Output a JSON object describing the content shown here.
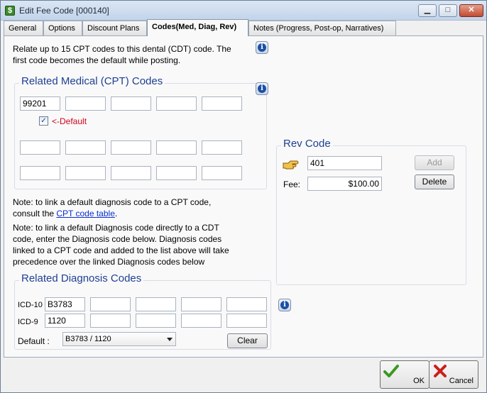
{
  "window": {
    "title": "Edit Fee Code [000140]",
    "buttons": {
      "minimize": "▁",
      "maximize": "□",
      "close": "✕"
    }
  },
  "tabs": [
    {
      "label": "General"
    },
    {
      "label": "Options"
    },
    {
      "label": "Discount Plans"
    },
    {
      "label": "Codes(Med, Diag, Rev)",
      "active": true
    },
    {
      "label": "Notes (Progress, Post-op, Narratives)"
    }
  ],
  "intro": {
    "line1": "Relate up to 15 CPT codes to this dental (CDT) code.  The",
    "line2": "first code becomes the default while posting."
  },
  "cpt": {
    "title": "Related Medical (CPT) Codes",
    "codes": [
      "99201",
      "",
      "",
      "",
      "",
      "",
      "",
      "",
      "",
      "",
      "",
      "",
      "",
      "",
      ""
    ],
    "default_checked": true,
    "default_label": "<-Default"
  },
  "notes": {
    "note1_line1": "Note: to link a default diagnosis code to a CPT code,",
    "note1_line2_prefix": "consult the ",
    "note1_link": "CPT code table",
    "note1_line2_suffix": ".",
    "note2_line1": "Note: to link a default Diagnosis code directly to a CDT",
    "note2_line2": "code, enter the Diagnosis code below. Diagnosis codes",
    "note2_line3": "linked to a CPT code and added to the list above will take",
    "note2_line4": "precedence over the linked Diagnosis codes below"
  },
  "diagnosis": {
    "title": "Related Diagnosis Codes",
    "icd10_label": "ICD-10",
    "icd9_label": "ICD-9",
    "icd10_codes": [
      "B3783",
      "",
      "",
      "",
      "",
      ""
    ],
    "icd9_codes": [
      "1120",
      "",
      "",
      "",
      "",
      ""
    ],
    "default_label": "Default :",
    "default_value": "B3783 / 1120",
    "clear_button": "Clear"
  },
  "rev": {
    "title": "Rev Code",
    "code": "401",
    "fee_label": "Fee:",
    "fee_value": "$100.00",
    "add_button": "Add",
    "delete_button": "Delete"
  },
  "footer": {
    "ok_button": "OK",
    "cancel_button": "Cancel"
  },
  "colors": {
    "group_title": "#1f3f93",
    "default_label": "#d0021b",
    "link": "#0a2fd1"
  }
}
